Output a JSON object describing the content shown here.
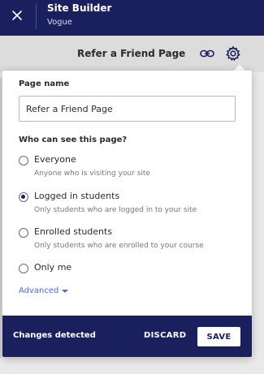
{
  "header": {
    "title": "Site Builder",
    "subtitle": "Vogue"
  },
  "backdrop": {
    "page_title": "Refer a Friend Page"
  },
  "popover": {
    "page_name_label": "Page name",
    "page_name_value": "Refer a Friend Page",
    "visibility_label": "Who can see this page?",
    "options": [
      {
        "label": "Everyone",
        "description": "Anyone who is visiting your site",
        "selected": false
      },
      {
        "label": "Logged in students",
        "description": "Only students who are logged in to your site",
        "selected": true
      },
      {
        "label": "Enrolled students",
        "description": "Only students who are enrolled to your course",
        "selected": false
      },
      {
        "label": "Only me",
        "description": "",
        "selected": false
      }
    ],
    "advanced_label": "Advanced"
  },
  "footer": {
    "status": "Changes detected",
    "discard_label": "DISCARD",
    "save_label": "SAVE"
  },
  "colors": {
    "brand": "#1a1f5e",
    "link": "#4a6ad6"
  },
  "icons": [
    "close-icon",
    "link-icon",
    "gear-icon",
    "chevron-down-icon"
  ]
}
